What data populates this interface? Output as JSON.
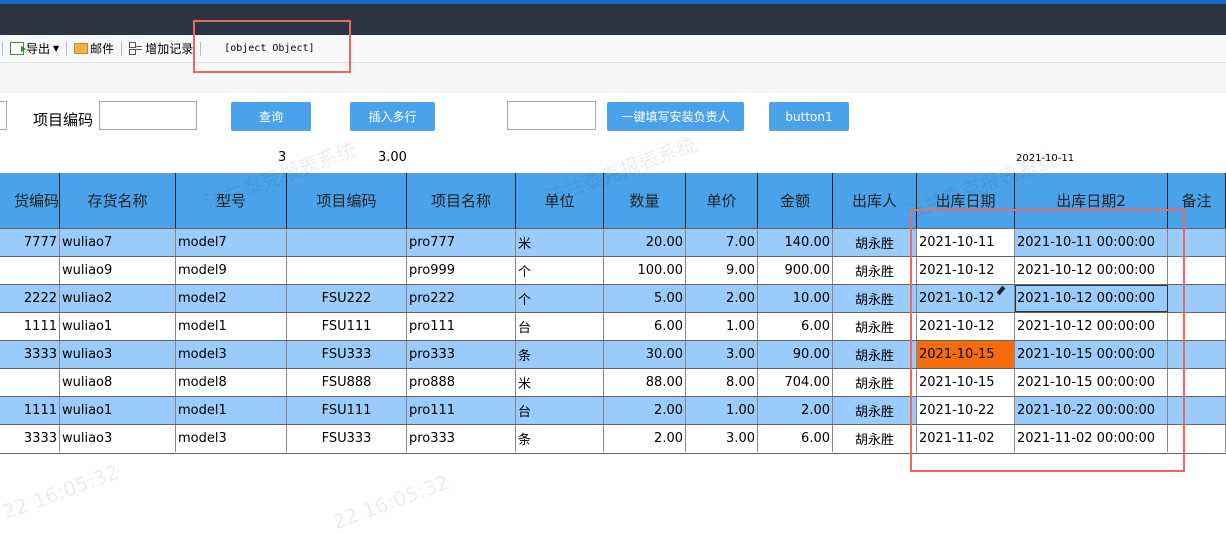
{
  "toolbar": {
    "export_label": "导出",
    "mail_label": "邮件",
    "add_record_label": "增加记录",
    "object_text": "[object Object]"
  },
  "filter": {
    "project_code_label": "项目编码",
    "project_code_value": "",
    "extra_value": "",
    "query_button": "查询",
    "insert_rows_button": "插入多行",
    "fill_installer_button": "一键填写安装负责人",
    "button1": "button1"
  },
  "summary": {
    "value1": "3",
    "value2": "3.00",
    "date": "2021-10-11"
  },
  "table": {
    "columns": [
      "货编码",
      "存货名称",
      "型号",
      "项目编码",
      "项目名称",
      "单位",
      "数量",
      "单价",
      "金额",
      "出库人",
      "出库日期",
      "出库日期2",
      "备注"
    ],
    "rows": [
      [
        "7777",
        "wuliao7",
        "model7",
        "",
        "pro777",
        "米",
        "20.00",
        "7.00",
        "140.00",
        "胡永胜",
        "2021-10-11",
        "2021-10-11 00:00:00",
        ""
      ],
      [
        "",
        "wuliao9",
        "model9",
        "",
        "pro999",
        "个",
        "100.00",
        "9.00",
        "900.00",
        "胡永胜",
        "2021-10-12",
        "2021-10-12 00:00:00",
        ""
      ],
      [
        "2222",
        "wuliao2",
        "model2",
        "FSU222",
        "pro222",
        "个",
        "5.00",
        "2.00",
        "10.00",
        "胡永胜",
        "2021-10-12",
        "2021-10-12 00:00:00",
        ""
      ],
      [
        "1111",
        "wuliao1",
        "model1",
        "FSU111",
        "pro111",
        "台",
        "6.00",
        "1.00",
        "6.00",
        "胡永胜",
        "2021-10-12",
        "2021-10-12 00:00:00",
        ""
      ],
      [
        "3333",
        "wuliao3",
        "model3",
        "FSU333",
        "pro333",
        "条",
        "30.00",
        "3.00",
        "90.00",
        "胡永胜",
        "2021-10-15",
        "2021-10-15 00:00:00",
        ""
      ],
      [
        "",
        "wuliao8",
        "model8",
        "FSU888",
        "pro888",
        "米",
        "88.00",
        "8.00",
        "704.00",
        "胡永胜",
        "2021-10-15",
        "2021-10-15 00:00:00",
        ""
      ],
      [
        "1111",
        "wuliao1",
        "model1",
        "FSU111",
        "pro111",
        "台",
        "2.00",
        "1.00",
        "2.00",
        "胡永胜",
        "2021-10-22",
        "2021-10-22 00:00:00",
        ""
      ],
      [
        "3333",
        "wuliao3",
        "model3",
        "FSU333",
        "pro333",
        "条",
        "2.00",
        "3.00",
        "6.00",
        "胡永胜",
        "2021-11-02",
        "2021-11-02 00:00:00",
        ""
      ]
    ]
  },
  "watermark": {
    "text1": "法兰泰克报表系统",
    "text2": "22 16:05:32"
  },
  "colors": {
    "header_bg": "#4aa3ea",
    "row_blue": "#99ccfa",
    "highlight_orange": "#f66b0a",
    "annotation_red": "#ee6a5e"
  }
}
